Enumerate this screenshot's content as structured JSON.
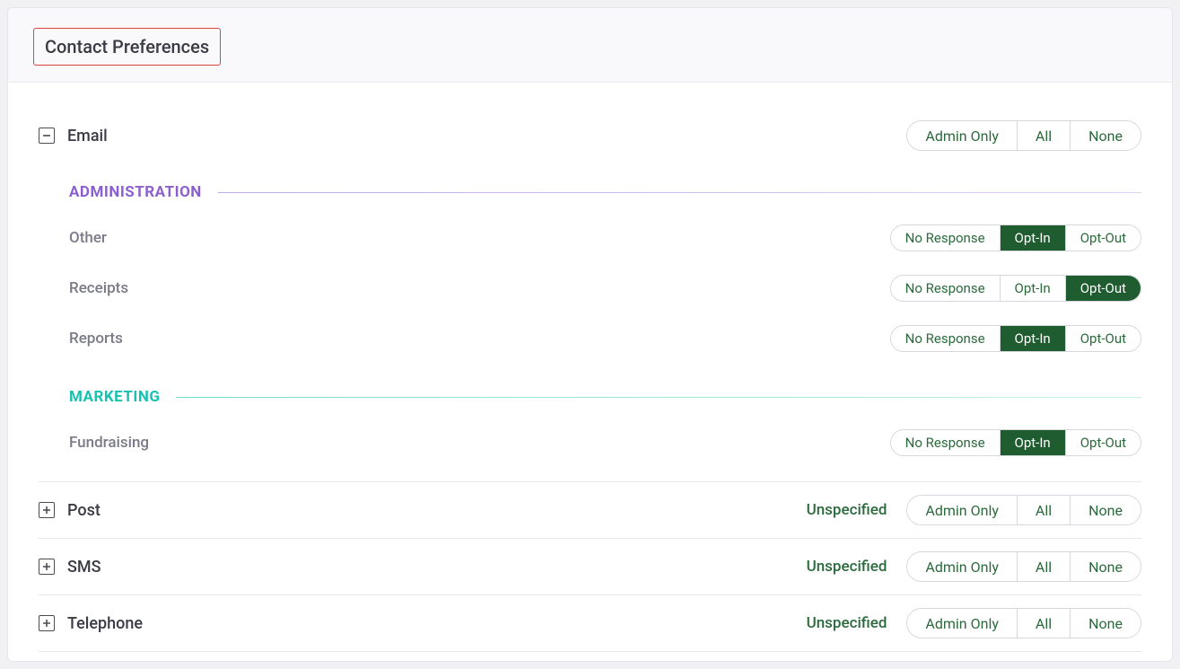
{
  "title": "Contact Preferences",
  "buttons": {
    "admin_only": "Admin Only",
    "all": "All",
    "none": "None",
    "no_response": "No Response",
    "opt_in": "Opt-In",
    "opt_out": "Opt-Out"
  },
  "status": {
    "unspecified": "Unspecified"
  },
  "groups": {
    "administration": "ADMINISTRATION",
    "marketing": "MARKETING"
  },
  "channels": {
    "email": {
      "label": "Email",
      "expanded": true,
      "groups": {
        "administration": [
          {
            "label": "Other",
            "selected": "opt_in"
          },
          {
            "label": "Receipts",
            "selected": "opt_out"
          },
          {
            "label": "Reports",
            "selected": "opt_in"
          }
        ],
        "marketing": [
          {
            "label": "Fundraising",
            "selected": "opt_in"
          }
        ]
      }
    },
    "post": {
      "label": "Post",
      "expanded": false,
      "status": "Unspecified"
    },
    "sms": {
      "label": "SMS",
      "expanded": false,
      "status": "Unspecified"
    },
    "telephone": {
      "label": "Telephone",
      "expanded": false,
      "status": "Unspecified"
    }
  }
}
